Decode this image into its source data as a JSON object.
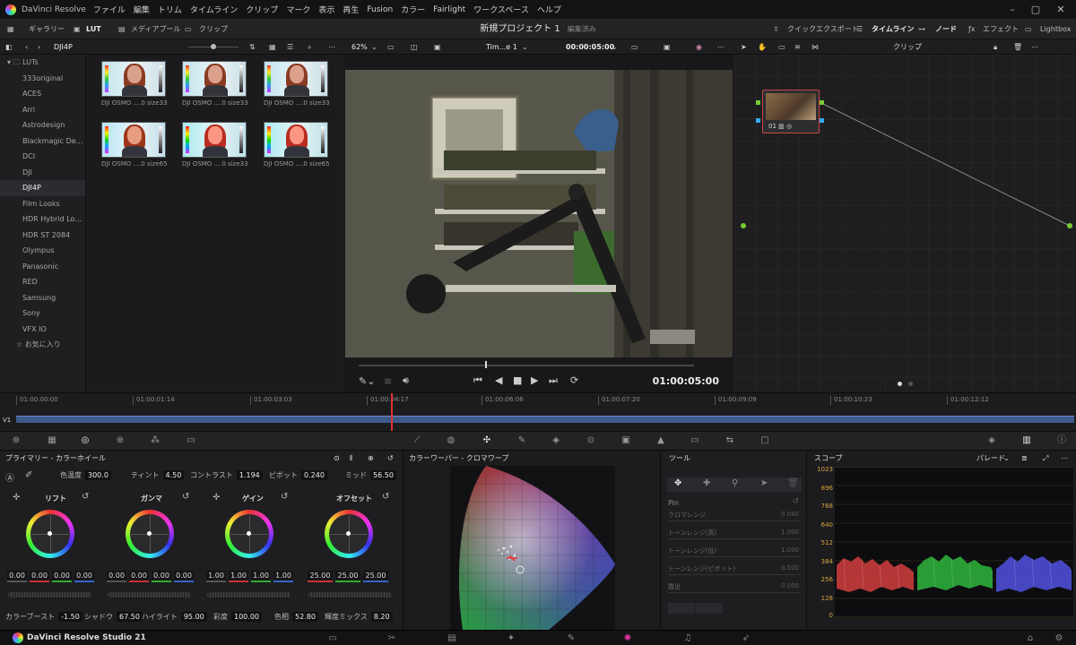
{
  "app": {
    "title": "DaVinci Resolve",
    "menu": [
      "ファイル",
      "編集",
      "トリム",
      "タイムライン",
      "クリップ",
      "マーク",
      "表示",
      "再生",
      "Fusion",
      "カラー",
      "Fairlight",
      "ワークスペース",
      "ヘルプ"
    ]
  },
  "toolbar": {
    "gallery": "ギャラリー",
    "lut": "LUT",
    "media_pool": "メディアプール",
    "clips": "クリップ",
    "project_name": "新規プロジェクト 1",
    "project_status": "編集済み",
    "quick_export": "クイックエクスポート",
    "timeline": "タイムライン",
    "nodes": "ノード",
    "effects": "エフェクト",
    "lightbox": "Lightbox"
  },
  "subbar": {
    "folder": "DJI4P",
    "zoom": "62%",
    "timeline_name": "Tim...e 1",
    "timecode": "00:00:05:00",
    "clip_dropdown": "クリップ"
  },
  "lut_browser": {
    "root": "LUTs",
    "items": [
      "333original",
      "ACES",
      "Arri",
      "Astrodesign",
      "Blackmagic Desi...",
      "DCI",
      "DJI",
      "DJI4P",
      "Film Looks",
      "HDR Hybrid Log...",
      "HDR ST 2084",
      "Olympus",
      "Panasonic",
      "RED",
      "Samsung",
      "Sony",
      "VFX IO"
    ],
    "selected": "DJI4P",
    "favorites": "お気に入り"
  },
  "thumbnails": [
    {
      "caption": "DJI OSMO ....0 size33"
    },
    {
      "caption": "DJI OSMO ....0 size33"
    },
    {
      "caption": "DJI OSMO ....0 size33"
    },
    {
      "caption": "DJI OSMO ....0 size65"
    },
    {
      "caption": "DJI OSMO ....0 size33"
    },
    {
      "caption": "DJI OSMO ....0 size65"
    }
  ],
  "viewer": {
    "timecode": "01:00:05:00"
  },
  "node": {
    "label": "01"
  },
  "timeline": {
    "ticks": [
      "01:00:00:00",
      "01:00:01:14",
      "01:00:03:03",
      "01:00:04:17",
      "01:00:06:06",
      "01:00:07:20",
      "01:00:09:09",
      "01:00:10:23",
      "01:00:12:12"
    ],
    "track": "V1"
  },
  "primaries": {
    "title": "プライマリー - カラーホイール",
    "params": [
      {
        "label": "色温度",
        "value": "300.0"
      },
      {
        "label": "ティント",
        "value": "4.50"
      },
      {
        "label": "コントラスト",
        "value": "1.194"
      },
      {
        "label": "ピボット",
        "value": "0.240"
      },
      {
        "label": "ミッド",
        "value": "56.50"
      }
    ],
    "wheels": [
      {
        "name": "リフト",
        "values": [
          "0.00",
          "0.00",
          "0.00",
          "0.00"
        ]
      },
      {
        "name": "ガンマ",
        "values": [
          "0.00",
          "0.00",
          "0.00",
          "0.00"
        ]
      },
      {
        "name": "ゲイン",
        "values": [
          "1.00",
          "1.00",
          "1.00",
          "1.00"
        ]
      },
      {
        "name": "オフセット",
        "values": [
          "25.00",
          "25.00",
          "25.00"
        ]
      }
    ],
    "bottom": [
      {
        "label": "カラーブースト",
        "value": "-1.50"
      },
      {
        "label": "シャドウ",
        "value": "67.50"
      },
      {
        "label": "ハイライト",
        "value": "95.00"
      },
      {
        "label": "彩度",
        "value": "100.00"
      },
      {
        "label": "色相",
        "value": "52.80"
      },
      {
        "label": "輝度ミックス",
        "value": "8.20"
      }
    ]
  },
  "warper": {
    "title": "カラーワーパー - クロマワープ"
  },
  "tools": {
    "title": "ツール",
    "pin": "Pin",
    "rows": [
      {
        "label": "クロマレンジ",
        "value": "0.040"
      },
      {
        "label": "トーンレンジ(高)",
        "value": "1.000"
      },
      {
        "label": "トーンレンジ(低)",
        "value": "1.000"
      },
      {
        "label": "トーンレンジ(ピボット)",
        "value": "0.500"
      },
      {
        "label": "霞出",
        "value": "0.000"
      }
    ]
  },
  "scopes": {
    "title": "スコープ",
    "mode": "パレード",
    "scale": [
      "1023",
      "896",
      "768",
      "640",
      "512",
      "384",
      "256",
      "128",
      "0"
    ]
  },
  "footer": {
    "app": "DaVinci Resolve Studio 21"
  }
}
